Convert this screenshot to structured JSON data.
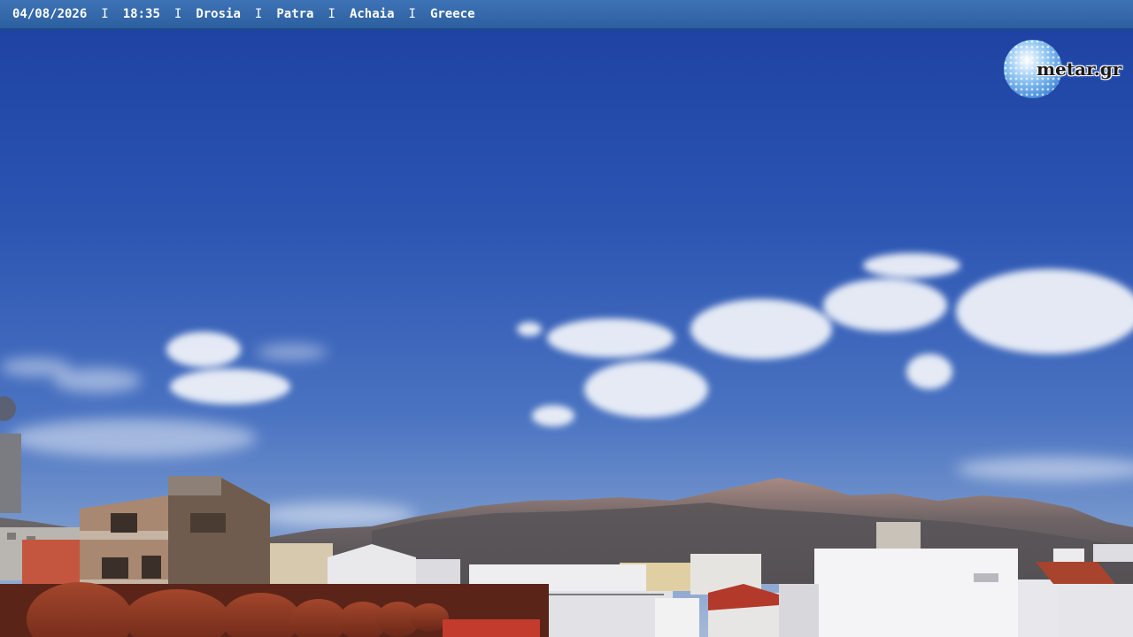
{
  "overlay": {
    "date": "04/08/2026",
    "time": "18:35",
    "place": "Drosia",
    "city": "Patra",
    "region": "Achaia",
    "country": "Greece",
    "separator": "I"
  },
  "logo": {
    "text": "metar.gr"
  },
  "colors": {
    "bar_bg": "#2c5f9f",
    "bar_text": "#ffffff",
    "sky_top": "#1f47a6",
    "sky_horizon": "#8faad2",
    "mountains": "#6f6a6c",
    "roof_tiles": "#9c3b25"
  }
}
